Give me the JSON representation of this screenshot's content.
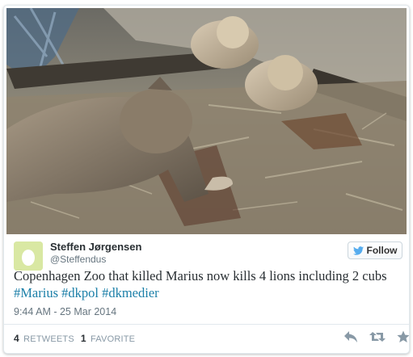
{
  "tweet": {
    "author_name": "Steffen Jørgensen",
    "author_handle": "@Steffendus",
    "follow_label": "Follow",
    "text_main": "Copenhagen Zoo that killed Marius now kills 4 lions including 2 cubs ",
    "hashtags": [
      "#Marius",
      "#dkpol",
      "#dkmedier"
    ],
    "timestamp": "9:44 AM - 25 Mar 2014",
    "retweets_count": "4",
    "retweets_label": "RETWEETS",
    "favorites_count": "1",
    "favorites_label": "FAVORITE"
  },
  "colors": {
    "hashtag": "#1b7fa8",
    "follow_bird": "#55acee",
    "avatar_bg": "#d9e8a3"
  },
  "icons": {
    "reply": "reply-icon",
    "retweet": "retweet-icon",
    "favorite": "star-icon",
    "follow": "twitter-bird-icon",
    "avatar": "egg-avatar-icon"
  }
}
